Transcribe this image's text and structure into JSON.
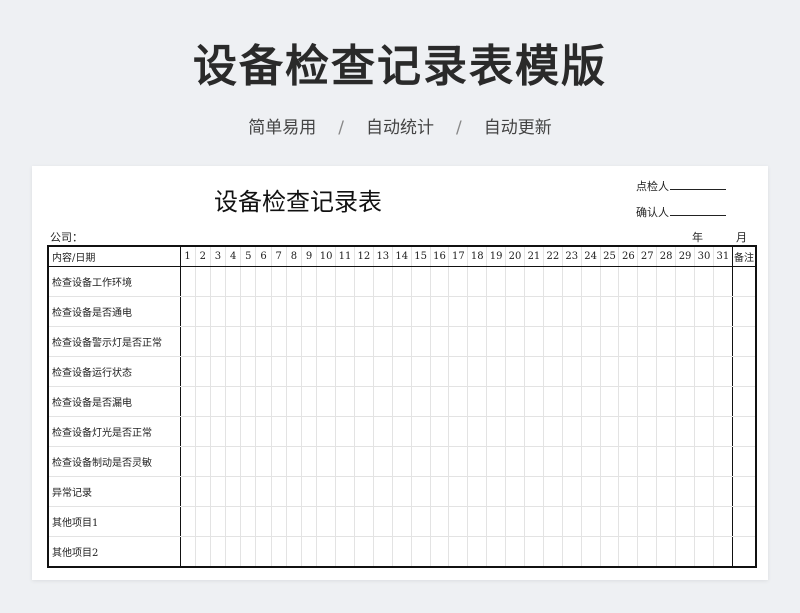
{
  "banner": {
    "title": "设备检查记录表模版",
    "subtitle": [
      "简单易用",
      "自动统计",
      "自动更新"
    ],
    "separator": "/"
  },
  "sheet": {
    "title": "设备检查记录表",
    "inspector_label": "点检人",
    "confirmer_label": "确认人",
    "company_label": "公司：",
    "year_label": "年",
    "month_label": "月",
    "table": {
      "corner_header": "内容/日期",
      "days": [
        "1",
        "2",
        "3",
        "4",
        "5",
        "6",
        "7",
        "8",
        "9",
        "10",
        "11",
        "12",
        "13",
        "14",
        "15",
        "16",
        "17",
        "18",
        "19",
        "20",
        "21",
        "22",
        "23",
        "24",
        "25",
        "26",
        "27",
        "28",
        "29",
        "30",
        "31"
      ],
      "remark_header": "备注",
      "rows": [
        "检查设备工作环境",
        "检查设备是否通电",
        "检查设备警示灯是否正常",
        "检查设备运行状态",
        "检查设备是否漏电",
        "检查设备灯光是否正常",
        "检查设备制动是否灵敏",
        "异常记录",
        "其他项目1",
        "其他项目2"
      ]
    }
  }
}
